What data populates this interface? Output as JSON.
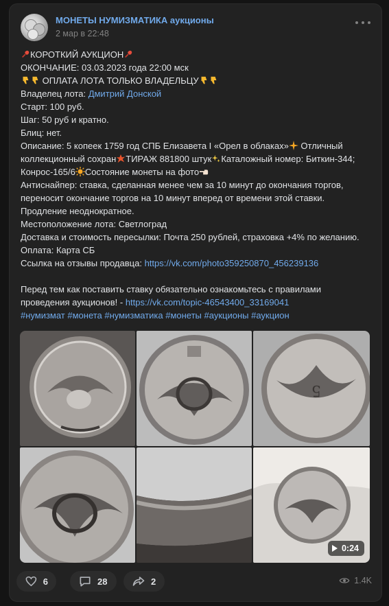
{
  "post": {
    "group_name": "МОНЕТЫ НУМИЗМАТИКА аукционы",
    "date": "2 мар в 22:48",
    "more_icon": "more-horizontal-icon",
    "lines": {
      "title": "КОРОТКИЙ АУКЦИОН",
      "ending": "ОКОНЧАНИЕ: 03.03.2023 года 22:00 мск",
      "payment_owner": "ОПЛАТА ЛОТА ТОЛЬКО ВЛАДЕЛЬЦУ",
      "owner_label": "Владелец лота: ",
      "owner_name": "Дмитрий Донской",
      "start": "Старт: 100 руб.",
      "step": "Шаг: 50 руб и кратно.",
      "blitz": "Блиц: нет.",
      "desc1": "Описание: 5 копеек 1759 год СПБ Елизавета I «Орел в облаках»",
      "desc1b": " Отличный",
      "desc2a": "коллекционный сохран",
      "desc2b": "ТИРАЖ 881800 штук",
      "desc2c": "Каталожный номер: Биткин-344;",
      "desc3a": "Конрос-165/6",
      "desc3b": "Состояние монеты на фото",
      "antisniper1": "Антиснайпер: ставка, сделанная менее чем за 10 минут до окончания торгов,",
      "antisniper2": "переносит окончание торгов на 10 минут вперед от времени этой ставки.",
      "prolong": "Продление неоднократное.",
      "location": "Местоположение лота: Светлоград",
      "delivery": "Доставка и стоимость пересылки: Почта 250 рублей, страховка +4% по желанию.",
      "pay": "Оплата: Карта СБ",
      "reviews_label": "Ссылка на отзывы продавца: ",
      "reviews_link": "https://vk.com/photo359250870_456239136",
      "rules1": "Перед тем как поставить ставку обязательно ознакомьтесь с правилами",
      "rules2": "проведения аукционов! - ",
      "rules_link": "https://vk.com/topic-46543400_33169041",
      "hashtags": "#нумизмат #монета #нумизматика #монеты #аукционы #аукцион"
    }
  },
  "gallery": {
    "photos": [
      "coin-obverse",
      "coin-obverse-closeup",
      "coin-reverse-rotated",
      "coin-detail",
      "coin-edge-macro",
      "coin-video"
    ],
    "video_duration": "0:24",
    "video_icon": "play-icon"
  },
  "footer": {
    "likes": "6",
    "comments": "28",
    "shares": "2",
    "views": "1.4K",
    "like_icon": "heart-icon",
    "comment_icon": "comment-icon",
    "share_icon": "share-icon",
    "views_icon": "eye-icon"
  },
  "colors": {
    "background": "#141414",
    "card": "#222222",
    "link": "#71aaeb",
    "text": "#e1e3e6",
    "muted": "#828282"
  }
}
